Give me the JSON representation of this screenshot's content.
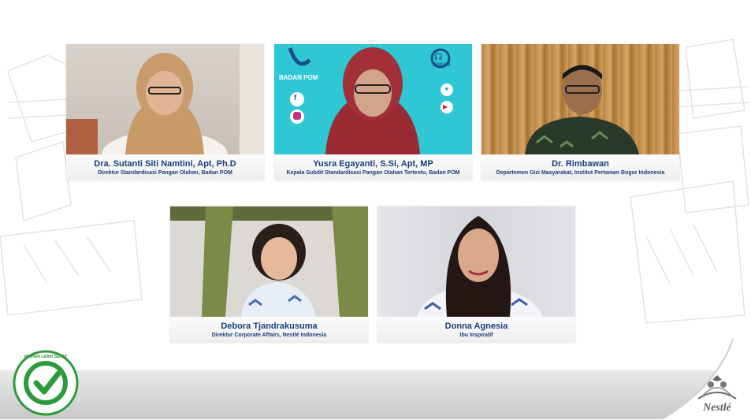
{
  "colors": {
    "caption_text": "#1a3d78",
    "badge_green": "#2e9b3b",
    "pom_teal": "#2fc7d4"
  },
  "participants": [
    {
      "name": "Dra. Sutanti Siti Namtini, Apt, Ph.D",
      "role": "Direktur Standardisasi Pangan Olahan, Badan POM"
    },
    {
      "name": "Yusra Egayanti, S.Si, Apt, MP",
      "role": "Kepala Subdit Standardisasi Pangan Olahan Tertentu, Badan POM"
    },
    {
      "name": "Dr. Rimbawan",
      "role": "Departemen Gizi Masyarakat, Institut Pertanian Bogor Indonesia"
    },
    {
      "name": "Debora Tjandrakusuma",
      "role": "Direktur Corporate Affairs, Nestlé Indonesia"
    },
    {
      "name": "Donna Agnesia",
      "role": "Ibu Inspiratif"
    }
  ],
  "pom_background": {
    "logo_text": "BADAN POM",
    "hotline": "1500533",
    "icons": [
      "facebook-icon",
      "instagram-icon",
      "twitter-icon",
      "youtube-icon",
      "headset-icon"
    ]
  },
  "badge": {
    "text": "PILIHAN LEBIH SEHAT",
    "icon": "checkmark-icon"
  },
  "brand": {
    "wordmark": "Nestlé",
    "icon": "nest-logo-icon"
  }
}
